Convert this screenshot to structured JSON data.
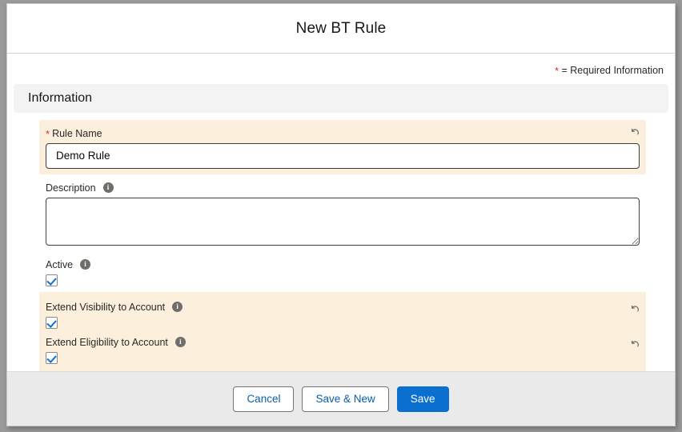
{
  "window": {
    "title": "New BT Rule"
  },
  "legend": {
    "star": "*",
    "text": "= Required Information"
  },
  "section": {
    "title": "Information"
  },
  "fields": {
    "rule_name": {
      "label": "Rule Name",
      "required_star": "*",
      "value": "Demo Rule",
      "placeholder": ""
    },
    "description": {
      "label": "Description",
      "value": "",
      "placeholder": ""
    },
    "active": {
      "label": "Active",
      "checked": true
    },
    "extend_visibility": {
      "label": "Extend Visibility to Account",
      "checked": true
    },
    "extend_eligibility": {
      "label": "Extend Eligibility to Account",
      "checked": true
    }
  },
  "icons": {
    "info": "i",
    "undo": "undo-arrow-icon"
  },
  "footer": {
    "cancel_label": "Cancel",
    "save_new_label": "Save & New",
    "save_label": "Save"
  },
  "colors": {
    "brand_blue": "#0b6fd0",
    "link_blue": "#0b5cab",
    "required_red": "#c23934",
    "highlight_bg": "#fcefdc",
    "section_bg": "#f3f3f3",
    "footer_bg": "#eaeaea",
    "page_bg": "#9a9a9a"
  }
}
